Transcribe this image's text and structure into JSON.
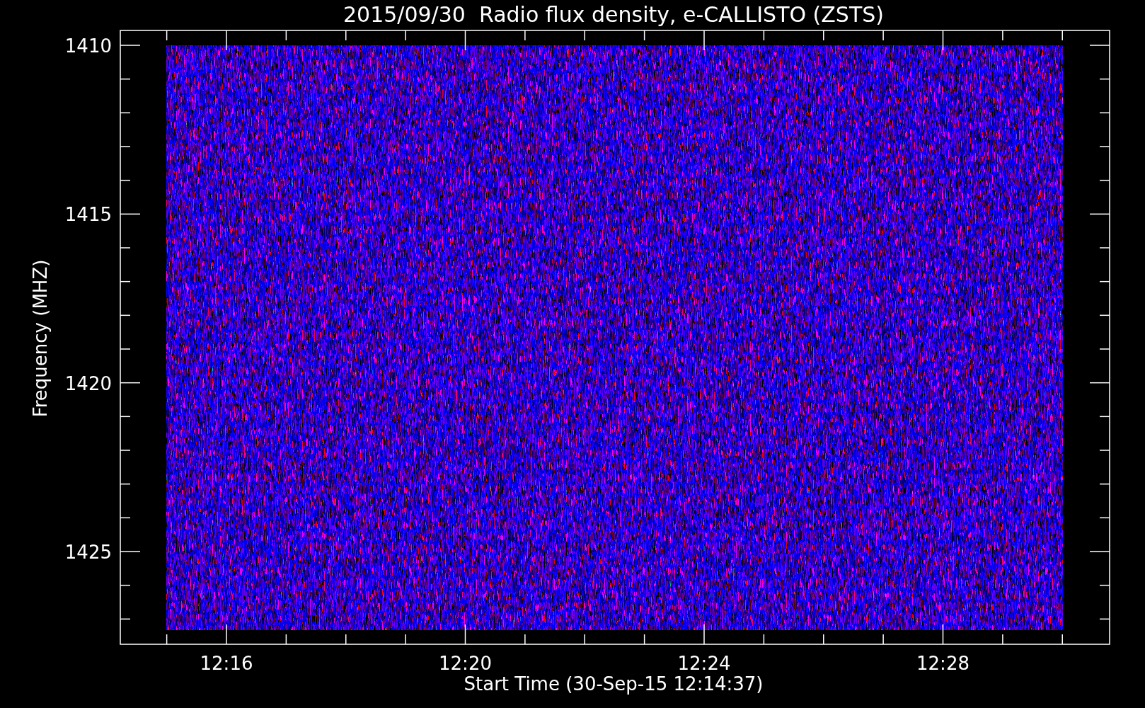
{
  "title": "2015/09/30  Radio flux density, e-CALLISTO (ZSTS)",
  "y_axis": {
    "label": "Frequency (MHZ)",
    "ticks": [
      "1410",
      "1415",
      "1420",
      "1425"
    ]
  },
  "x_axis": {
    "label": "Start Time (30-Sep-15 12:14:37)",
    "ticks": [
      "12:16",
      "12:20",
      "12:24",
      "12:28"
    ]
  }
}
